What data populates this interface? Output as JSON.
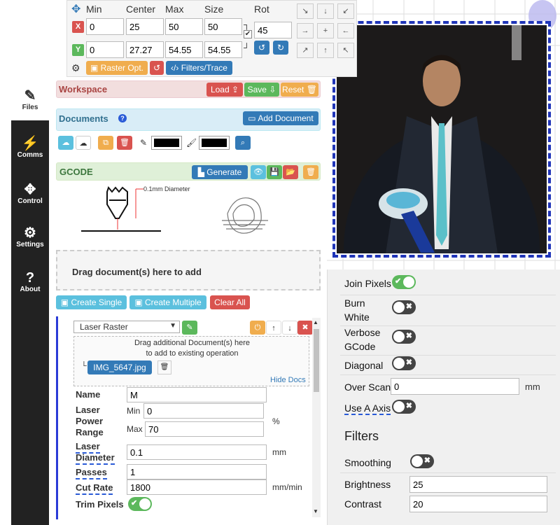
{
  "nav": {
    "files": "Files",
    "comms": "Comms",
    "control": "Control",
    "settings": "Settings",
    "about": "About"
  },
  "transform": {
    "col_min": "Min",
    "col_center": "Center",
    "col_max": "Max",
    "col_size": "Size",
    "col_rot": "Rot",
    "x_badge": "X",
    "y_badge": "Y",
    "x_min": "0",
    "x_center": "25",
    "x_max": "50",
    "x_size": "50",
    "rot": "45",
    "y_min": "0",
    "y_center": "27.27",
    "y_max": "54.55",
    "y_size": "54.55",
    "raster_opt": "Raster Opt.",
    "filters_trace": "Filters/Trace"
  },
  "workspace": {
    "title": "Workspace",
    "load": "Load",
    "save": "Save",
    "reset": "Reset"
  },
  "documents": {
    "title": "Documents",
    "add": "Add Document"
  },
  "gcode": {
    "title": "GCODE",
    "generate": "Generate",
    "diameter_note": "0.1mm Diameter"
  },
  "drop": {
    "text": "Drag document(s) here to add",
    "create_single": "Create Single",
    "create_multiple": "Create Multiple",
    "clear_all": "Clear All"
  },
  "operation": {
    "type": "Laser Raster",
    "drag_hint_1": "Drag additional Document(s) here",
    "drag_hint_2": "to add to existing operation",
    "doc_name": "IMG_5647.jpg",
    "hide_docs": "Hide Docs",
    "name_label": "Name",
    "name_value": "M",
    "power_label_1": "Laser",
    "power_label_2": "Power",
    "power_label_3": "Range",
    "min_label": "Min",
    "min_value": "0",
    "max_label": "Max",
    "max_value": "70",
    "power_unit": "%",
    "diameter_label_1": "Laser",
    "diameter_label_2": "Diameter",
    "diameter_value": "0.1",
    "diameter_unit": "mm",
    "passes_label": "Passes",
    "passes_value": "1",
    "cutrate_label": "Cut Rate",
    "cutrate_value": "1800",
    "cutrate_unit": "mm/min",
    "trim_label": "Trim Pixels"
  },
  "raster": {
    "join_pixels": "Join Pixels",
    "burn_white_1": "Burn",
    "burn_white_2": "White",
    "verbose_1": "Verbose",
    "verbose_2": "GCode",
    "diagonal": "Diagonal",
    "overscan_label": "Over Scan",
    "overscan_value": "0",
    "overscan_unit": "mm",
    "use_a_axis": "Use A Axis",
    "filters_title": "Filters",
    "smoothing": "Smoothing",
    "brightness_label": "Brightness",
    "brightness_value": "25",
    "contrast_label": "Contrast",
    "contrast_value": "20"
  },
  "colors": {
    "nav_bg": "#222222",
    "primary": "#337ab7",
    "success": "#5cb85c",
    "warning": "#f0ad4e",
    "danger": "#d9534f",
    "info": "#5bc0de"
  }
}
